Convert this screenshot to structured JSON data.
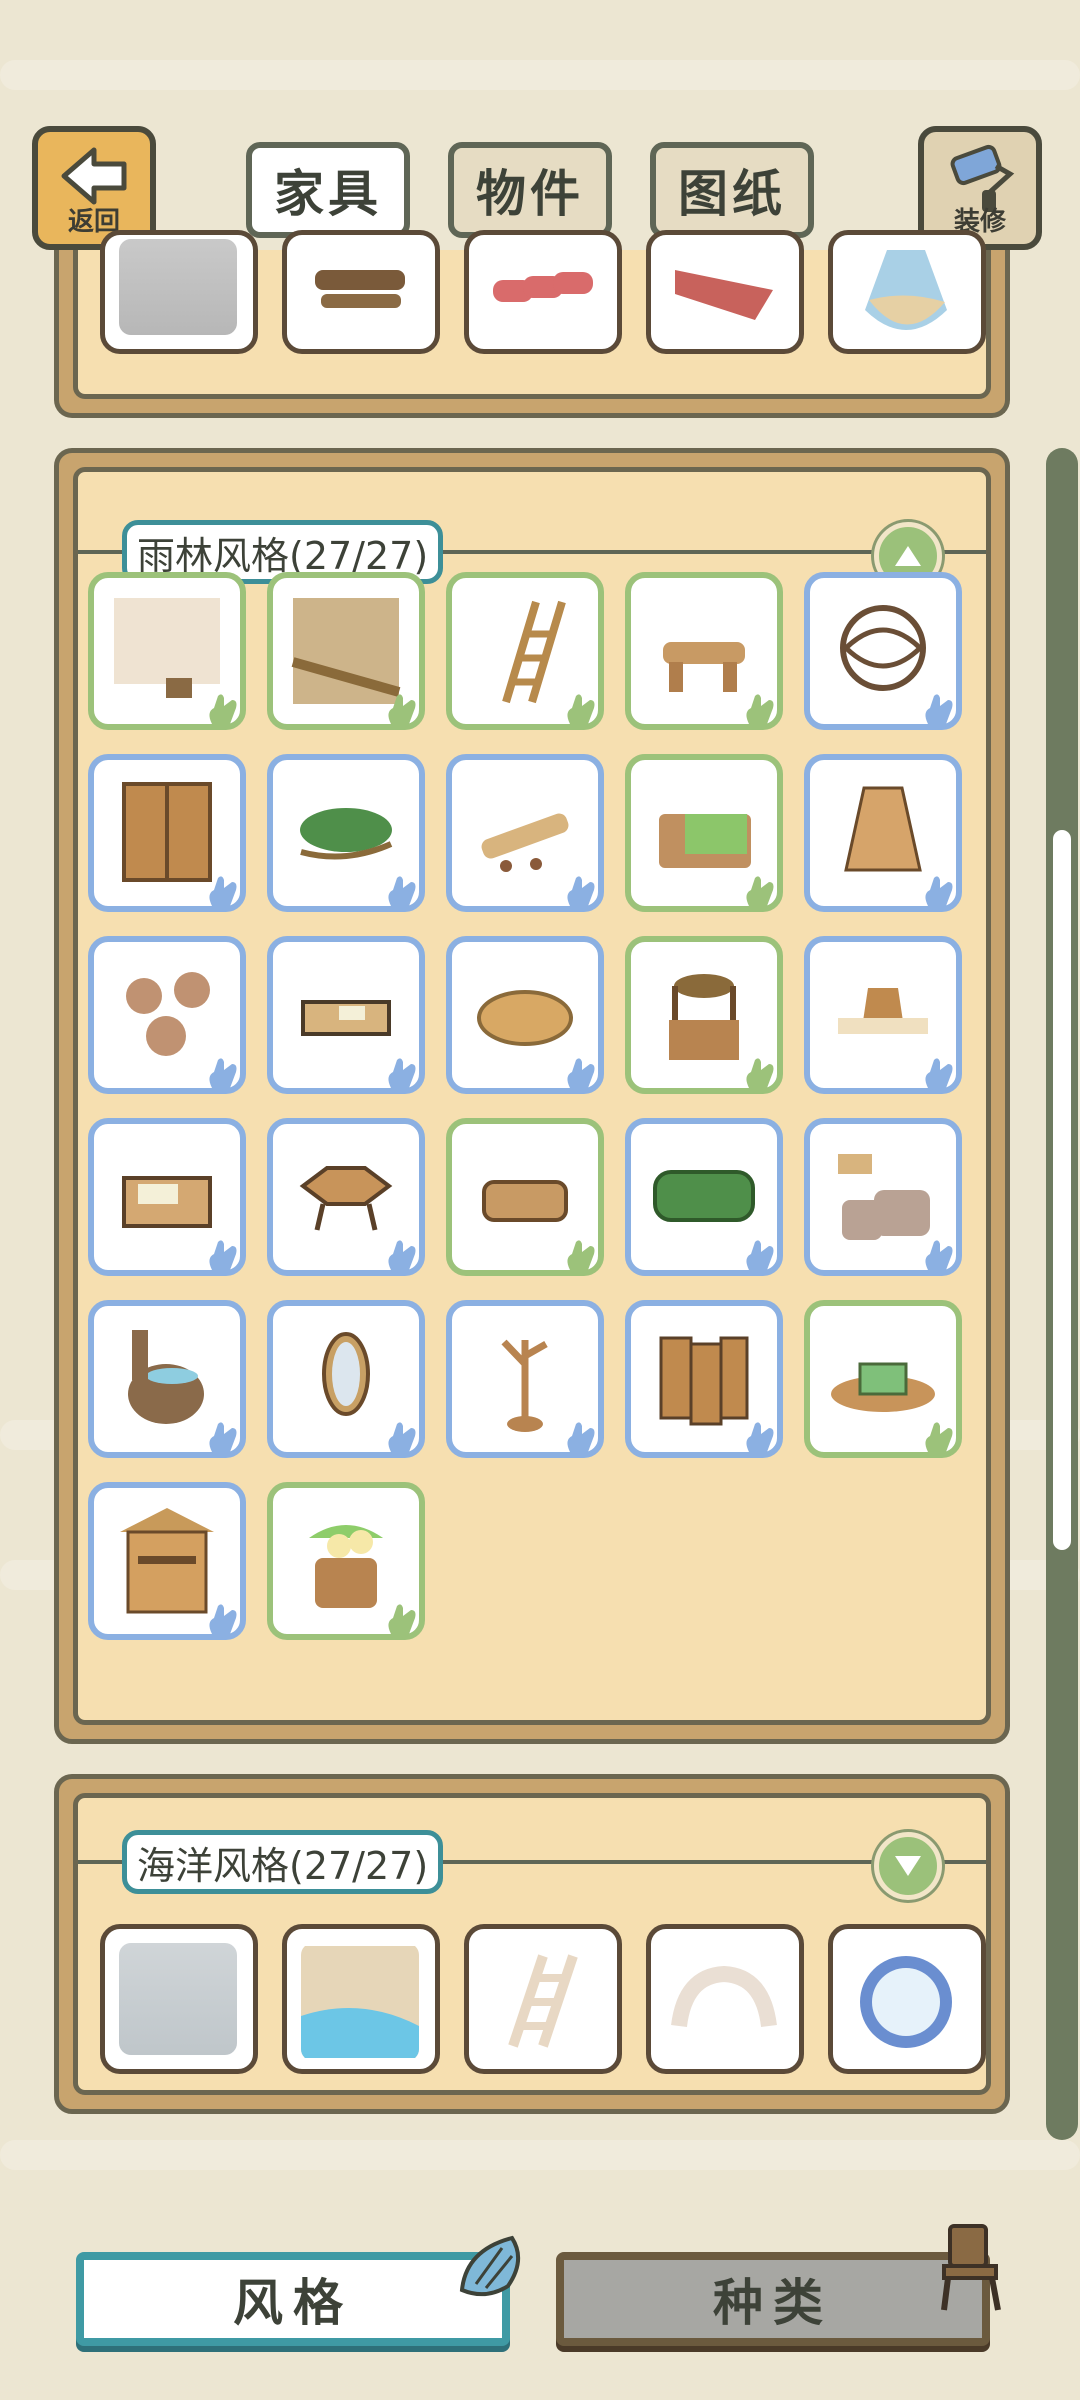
{
  "header": {
    "back_label": "返回",
    "decorate_label": "装修",
    "tabs": [
      {
        "label": "家具",
        "active": true
      },
      {
        "label": "物件",
        "active": false
      },
      {
        "label": "图纸",
        "active": false
      }
    ]
  },
  "sections": [
    {
      "title": "雨林风格(27/27)",
      "toggle_icon": "collapse-up-icon"
    },
    {
      "title": "海洋风格(27/27)",
      "toggle_icon": "expand-down-icon"
    }
  ],
  "bottom_tabs": [
    {
      "label": "风格",
      "active": true,
      "icon": "shell-icon"
    },
    {
      "label": "种类",
      "active": false,
      "icon": "chair-icon"
    }
  ],
  "colors": {
    "blue_border": "#8bb0e2",
    "green_border": "#9cc27a",
    "panel_bg": "#f6dfb0",
    "accent_teal": "#3d8f98"
  }
}
